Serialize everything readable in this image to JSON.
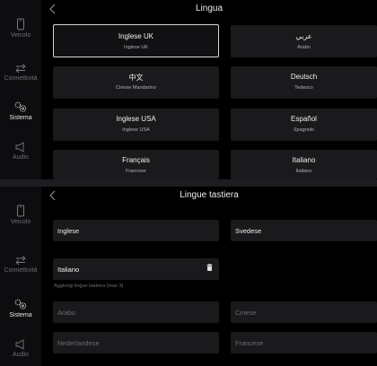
{
  "nav": [
    {
      "id": "veicolo",
      "label": "Veicolo",
      "icon": "phone-icon"
    },
    {
      "id": "connettivita",
      "label": "Connettività",
      "icon": "arrows-icon"
    },
    {
      "id": "sistema",
      "label": "Sistema",
      "icon": "gears-icon"
    },
    {
      "id": "audio",
      "label": "Audio",
      "icon": "speaker-icon"
    }
  ],
  "screen1": {
    "title": "Lingua",
    "languages": [
      {
        "name": "Inglese UK",
        "sub": "Inglese UK",
        "selected": true
      },
      {
        "name": "عربي",
        "sub": "Arabo"
      },
      {
        "name": "中文",
        "sub": "Cinese Mandarino"
      },
      {
        "name": "Deutsch",
        "sub": "Tedesco"
      },
      {
        "name": "Inglese USA",
        "sub": "Inglese USA"
      },
      {
        "name": "Español",
        "sub": "Spagnolo"
      },
      {
        "name": "Français",
        "sub": "Francese"
      },
      {
        "name": "Italiano",
        "sub": "Italiano"
      }
    ]
  },
  "screen2": {
    "title": "Lingue tastiera",
    "active": [
      "Inglese",
      "Svedese",
      "Italiano"
    ],
    "hint": "Aggiungi lingue tastiera (max 3)",
    "available": [
      "Arabo",
      "Cinese",
      "Nederlandese",
      "Francese"
    ]
  },
  "colors": {
    "accent": "#d6d6d6",
    "card": "#1a1a1d",
    "sidebar": "#0d0d0f"
  }
}
